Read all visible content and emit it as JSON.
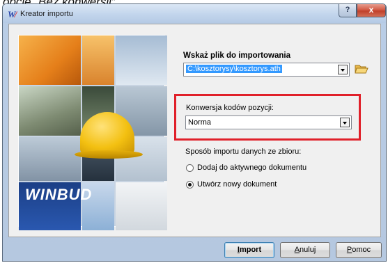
{
  "document_text": "opcję „Bez konwersji”.",
  "window": {
    "title": "Kreator importu",
    "help_button": "?",
    "close_button": "x"
  },
  "brand": {
    "logo_text": "WINBUD"
  },
  "file_section": {
    "label": "Wskaż plik do importowania",
    "value": "C:\\kosztorysy\\kosztorys.ath"
  },
  "conversion": {
    "label": "Konwersja kodów pozycji:",
    "value": "Norma",
    "highlight_color": "#e0202a"
  },
  "import_mode": {
    "label": "Sposób importu danych ze zbioru:",
    "options": [
      {
        "label": "Dodaj do aktywnego dokumentu",
        "selected": false
      },
      {
        "label": "Utwórz nowy dokument",
        "selected": true
      }
    ]
  },
  "buttons": {
    "import": {
      "first": "I",
      "rest": "mport"
    },
    "cancel": {
      "first": "A",
      "rest": "nuluj"
    },
    "help": {
      "first": "P",
      "rest": "omoc"
    }
  }
}
